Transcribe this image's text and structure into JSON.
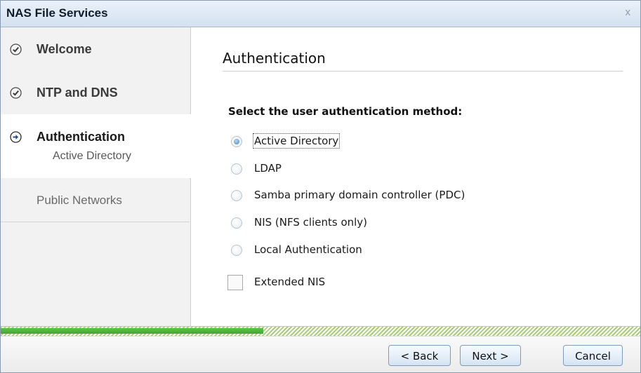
{
  "dialog": {
    "title": "NAS File Services",
    "close_label": "x"
  },
  "sidebar": {
    "steps": [
      {
        "label": "Welcome",
        "status": "complete",
        "icon": "check-circle-icon"
      },
      {
        "label": "NTP and DNS",
        "status": "complete",
        "icon": "check-circle-icon"
      },
      {
        "label": "Authentication",
        "sublabel": "Active Directory",
        "status": "current",
        "icon": "arrow-right-circle-icon"
      },
      {
        "label": "Public Networks",
        "status": "pending"
      }
    ]
  },
  "main": {
    "heading": "Authentication",
    "question": "Select the user authentication method:",
    "options": [
      {
        "label": "Active Directory",
        "selected": true
      },
      {
        "label": "LDAP",
        "selected": false
      },
      {
        "label": "Samba primary domain controller (PDC)",
        "selected": false
      },
      {
        "label": "NIS (NFS clients only)",
        "selected": false
      },
      {
        "label": "Local Authentication",
        "selected": false
      }
    ],
    "extended_nis": {
      "label": "Extended NIS",
      "checked": false
    }
  },
  "progress": {
    "value": 0.41
  },
  "footer": {
    "back_label": "< Back",
    "next_label": "Next >",
    "cancel_label": "Cancel"
  },
  "colors": {
    "accent": "#4a86c6",
    "progress_green": "#3ea63f",
    "title_gradient_top": "#eaf1fa",
    "title_gradient_bottom": "#d4e1ef"
  }
}
